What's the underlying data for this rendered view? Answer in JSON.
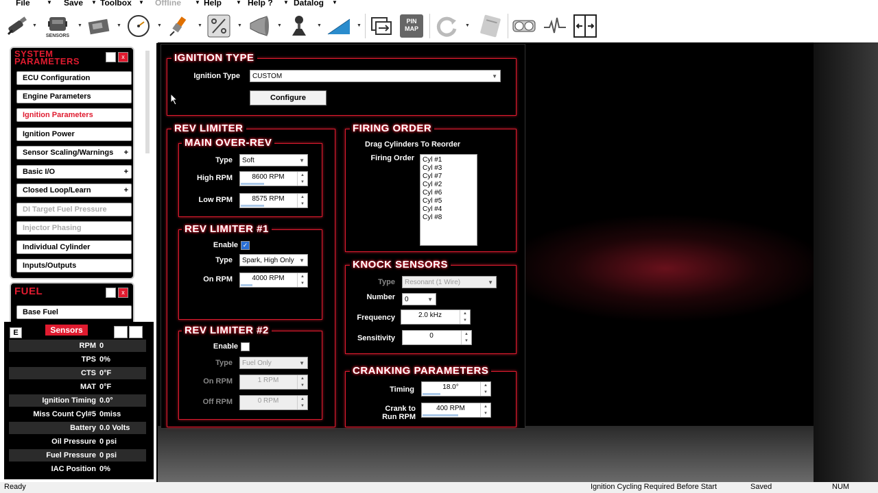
{
  "menu": {
    "items": [
      {
        "label": "File",
        "disabled": false
      },
      {
        "label": "Save",
        "disabled": false
      },
      {
        "label": "Toolbox",
        "disabled": false
      },
      {
        "label": "Offline",
        "disabled": true
      },
      {
        "label": "Help",
        "disabled": false
      },
      {
        "label": "Help ?",
        "disabled": false
      },
      {
        "label": "Datalog",
        "disabled": false
      }
    ]
  },
  "toolbar": {
    "sensors_label": "SENSORS",
    "pinmap_label": "PIN MAP",
    "icons": [
      "injector-icon",
      "sensors-icon",
      "ecu-icon",
      "gauge-icon",
      "spark-plug-icon",
      "percent-icon",
      "horn-icon",
      "joystick-icon",
      "ramp-icon",
      "transfer-icon",
      "pin-map-icon",
      "refresh-icon",
      "notepad-icon",
      "dash-icon",
      "waveform-icon",
      "expand-icon"
    ]
  },
  "system_panel": {
    "title": "SYSTEM PARAMETERS",
    "items": [
      {
        "label": "ECU Configuration",
        "state": "normal",
        "plus": false
      },
      {
        "label": "Engine Parameters",
        "state": "normal",
        "plus": false
      },
      {
        "label": "Ignition Parameters",
        "state": "active",
        "plus": false
      },
      {
        "label": "Ignition Power",
        "state": "normal",
        "plus": false
      },
      {
        "label": "Sensor Scaling/Warnings",
        "state": "normal",
        "plus": true
      },
      {
        "label": "Basic I/O",
        "state": "normal",
        "plus": true
      },
      {
        "label": "Closed Loop/Learn",
        "state": "normal",
        "plus": true
      },
      {
        "label": "DI Target Fuel Pressure",
        "state": "disabled",
        "plus": false
      },
      {
        "label": "Injector Phasing",
        "state": "disabled",
        "plus": false
      },
      {
        "label": "Individual Cylinder",
        "state": "normal",
        "plus": false
      },
      {
        "label": "Inputs/Outputs",
        "state": "normal",
        "plus": false
      }
    ],
    "close": "x"
  },
  "fuel_panel": {
    "title": "FUEL",
    "items": [
      {
        "label": "Base Fuel"
      }
    ],
    "close": "x"
  },
  "sensors": {
    "e_label": "E",
    "title": "Sensors",
    "rows": [
      {
        "label": "RPM",
        "value": "0"
      },
      {
        "label": "TPS",
        "value": "0%"
      },
      {
        "label": "CTS",
        "value": "0°F"
      },
      {
        "label": "MAT",
        "value": "0°F"
      },
      {
        "label": "Ignition Timing",
        "value": "0.0°"
      },
      {
        "label": "Miss Count Cyl#5",
        "value": "0miss"
      },
      {
        "label": "Battery",
        "value": "0.0 Volts"
      },
      {
        "label": "Oil Pressure",
        "value": "0 psi"
      },
      {
        "label": "Fuel Pressure",
        "value": "0 psi"
      },
      {
        "label": "IAC Position",
        "value": "0%"
      }
    ]
  },
  "ignition_type": {
    "title": "IGNITION TYPE",
    "label": "Ignition Type",
    "value": "CUSTOM",
    "configure": "Configure"
  },
  "rev_limiter": {
    "title": "REV LIMITER",
    "main": {
      "title": "MAIN OVER-REV",
      "type_label": "Type",
      "type_value": "Soft",
      "high_label": "High RPM",
      "high_value": "8600 RPM",
      "high_fill": 0.4,
      "low_label": "Low RPM",
      "low_value": "8575 RPM",
      "low_fill": 0.4
    },
    "one": {
      "title": "REV LIMITER #1",
      "enable_label": "Enable",
      "enabled": true,
      "type_label": "Type",
      "type_value": "Spark, High Only",
      "on_label": "On RPM",
      "on_value": "4000 RPM",
      "on_fill": 0.2
    },
    "two": {
      "title": "REV LIMITER #2",
      "enable_label": "Enable",
      "enabled": false,
      "type_label": "Type",
      "type_value": "Fuel Only",
      "on_label": "On RPM",
      "on_value": "1 RPM",
      "off_label": "Off RPM",
      "off_value": "0 RPM"
    }
  },
  "firing_order": {
    "title": "FIRING ORDER",
    "hint": "Drag Cylinders To Reorder",
    "label": "Firing Order",
    "cylinders": [
      "Cyl #1",
      "Cyl #3",
      "Cyl #7",
      "Cyl #2",
      "Cyl #6",
      "Cyl #5",
      "Cyl #4",
      "Cyl #8"
    ]
  },
  "knock": {
    "title": "KNOCK SENSORS",
    "type_label": "Type",
    "type_value": "Resonant (1 Wire)",
    "number_label": "Number",
    "number_value": "0",
    "freq_label": "Frequency",
    "freq_value": "2.0 kHz",
    "sens_label": "Sensitivity",
    "sens_value": "0"
  },
  "cranking": {
    "title": "CRANKING PARAMETERS",
    "timing_label": "Timing",
    "timing_value": "18.0°",
    "timing_fill": 0.3,
    "crank_label_1": "Crank to",
    "crank_label_2": "Run RPM",
    "crank_value": "400 RPM",
    "crank_fill": 0.6
  },
  "status": {
    "left": "Ready",
    "message": "Ignition Cycling Required Before Start",
    "saved": "Saved",
    "num": "NUM"
  },
  "colors": {
    "accent": "#e01b2f",
    "panel_bg": "#000000"
  }
}
